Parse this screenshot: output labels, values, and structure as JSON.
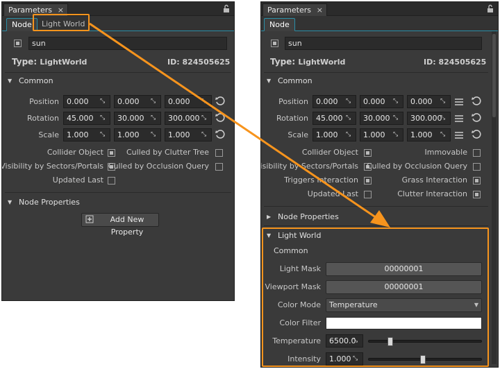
{
  "left": {
    "title_tab": "Parameters",
    "tabs": [
      {
        "label": "Node"
      },
      {
        "label": "Light World"
      }
    ],
    "name_value": "sun",
    "type_label": "Type:",
    "type_value": "LightWorld",
    "id_text": "ID: 824505625",
    "common_label": "Common",
    "position_label": "Position",
    "rotation_label": "Rotation",
    "scale_label": "Scale",
    "position": [
      "0.000",
      "0.000",
      "0.000"
    ],
    "rotation": [
      "45.000",
      "30.000",
      "300.000"
    ],
    "scale": [
      "1.000",
      "1.000",
      "1.000"
    ],
    "options": {
      "collider_object": "Collider Object",
      "culled_by_clutter_tree": "Culled by Clutter Tree",
      "visibility_by_sectors": "Visibility by Sectors/Portals",
      "culled_by_occlusion": "Culled by Occlusion Query",
      "updated_last": "Updated Last"
    },
    "node_properties_label": "Node Properties",
    "add_property_label": "Add New Property"
  },
  "right": {
    "title_tab": "Parameters",
    "tabs": [
      {
        "label": "Node"
      }
    ],
    "name_value": "sun",
    "type_label": "Type:",
    "type_value": "LightWorld",
    "id_text": "ID: 824505625",
    "common_label": "Common",
    "position_label": "Position",
    "rotation_label": "Rotation",
    "scale_label": "Scale",
    "position": [
      "0.000",
      "0.000",
      "0.000"
    ],
    "rotation": [
      "45.000",
      "30.000",
      "300.000"
    ],
    "scale": [
      "1.000",
      "1.000",
      "1.000"
    ],
    "options": {
      "collider_object": "Collider Object",
      "immovable": "Immovable",
      "visibility_by_sectors": "Visibility by Sectors/Portals",
      "culled_by_occlusion": "Culled by Occlusion Query",
      "triggers_interaction": "Triggers Interaction",
      "grass_interaction": "Grass Interaction",
      "updated_last": "Updated Last",
      "clutter_interaction": "Clutter Interaction"
    },
    "node_properties_label": "Node Properties",
    "light_world_label": "Light World",
    "light_world_common": "Common",
    "light_mask_label": "Light Mask",
    "light_mask_value": "00000001",
    "viewport_mask_label": "Viewport Mask",
    "viewport_mask_value": "00000001",
    "color_mode_label": "Color Mode",
    "color_mode_value": "Temperature",
    "color_filter_label": "Color Filter",
    "color_filter_value": "#ffffff",
    "temperature_label": "Temperature",
    "temperature_value": "6500.0",
    "temperature_slider_fraction": 0.18,
    "intensity_label": "Intensity",
    "intensity_value": "1.000",
    "intensity_slider_fraction": 0.48
  },
  "colors": {
    "highlight": "#f7941d",
    "panel_bg": "#3a3a3a",
    "active_tab_border": "#2a8fa8"
  }
}
